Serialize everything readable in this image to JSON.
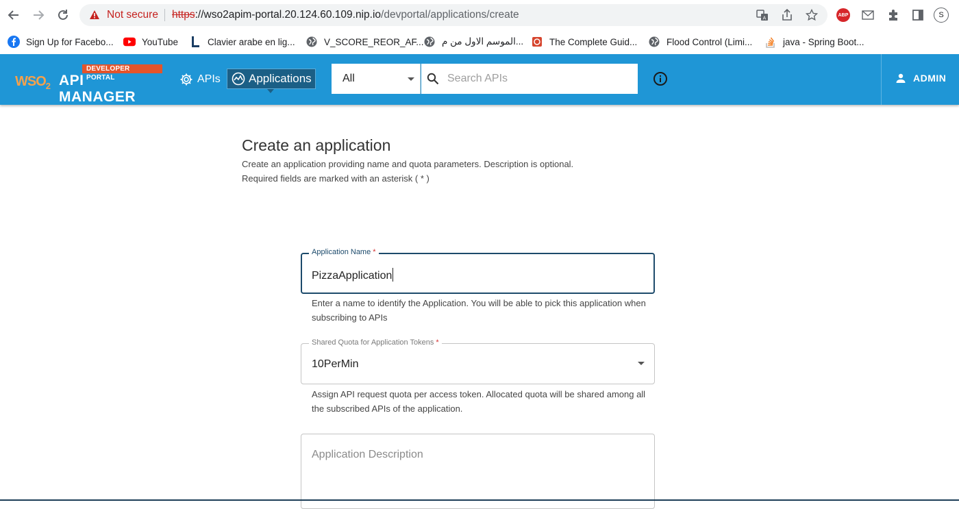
{
  "browser": {
    "not_secure": "Not secure",
    "url_scheme": "https",
    "url_rest_host": "://wso2apim-portal.20.124.60.109.nip.io",
    "url_path": "/devportal/applications/create",
    "profile_initial": "S",
    "bookmarks": [
      {
        "label": "Sign Up for Facebo...",
        "icon": "facebook-icon"
      },
      {
        "label": "YouTube",
        "icon": "youtube-icon"
      },
      {
        "label": "Clavier arabe en lig...",
        "icon": "l-letter-icon"
      },
      {
        "label": "V_SCORE_REOR_AF...",
        "icon": "globe-icon"
      },
      {
        "label": "الموسم الاول من م...",
        "icon": "globe-icon"
      },
      {
        "label": "The Complete Guid...",
        "icon": "red-square-icon"
      },
      {
        "label": "Flood Control (Limi...",
        "icon": "globe-icon"
      },
      {
        "label": "java - Spring Boot...",
        "icon": "stackoverflow-icon"
      }
    ]
  },
  "header": {
    "badge": "DEVELOPER PORTAL",
    "logo_wso": "WSO",
    "logo_sub": "2",
    "product": "API MANAGER",
    "nav_apis": "APIs",
    "nav_applications": "Applications",
    "search_scope": "All",
    "search_placeholder": "Search APIs",
    "user": "ADMIN"
  },
  "page": {
    "title": "Create an application",
    "subtitle": "Create an application providing name and quota parameters. Description is optional.",
    "required_note": "Required fields are marked with an asterisk ( * )",
    "name_label": "Application Name",
    "name_value": "PizzaApplication",
    "name_helper": "Enter a name to identify the Application. You will be able to pick this application when subscribing to APIs",
    "quota_label": "Shared Quota for Application Tokens",
    "quota_value": "10PerMin",
    "quota_helper": "Assign API request quota per access token. Allocated quota will be shared among all the subscribed APIs of the application.",
    "description_placeholder": "Application Description",
    "asterisk": "*"
  },
  "colors": {
    "appbar": "#1f96d6",
    "active_nav": "#1b5f86",
    "focused_border": "#1c4a6b",
    "badge": "#e3542b"
  }
}
